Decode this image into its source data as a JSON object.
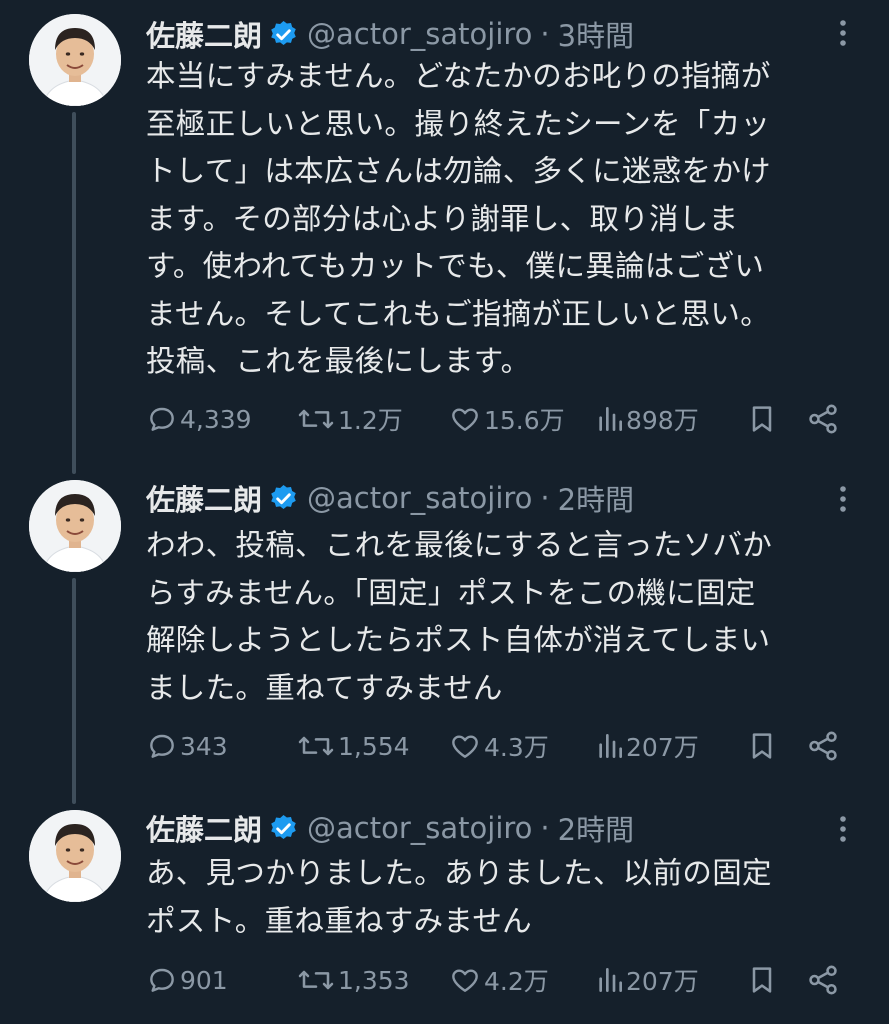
{
  "thread": [
    {
      "name": "佐藤二朗",
      "handle": "@actor_satojiro",
      "separator": "·",
      "time": "3時間",
      "lines": [
        "本当にすみません。どなたかのお叱りの指摘が",
        "至極正しいと思い。撮り終えたシーンを「カッ",
        "トして」は本広さんは勿論、多くに迷惑をかけ",
        "ます。その部分は心より謝罪し、取り消しま",
        "す。使われてもカットでも、僕に異論はござい",
        "ません。そしてこれもご指摘が正しいと思い。",
        "投稿、これを最後にします。"
      ],
      "replies": "4,339",
      "reposts": "1.2万",
      "likes": "15.6万",
      "views": "898万"
    },
    {
      "name": "佐藤二朗",
      "handle": "@actor_satojiro",
      "separator": "·",
      "time": "2時間",
      "lines": [
        "わわ、投稿、これを最後にすると言ったソバか",
        "らすみません。「固定」ポストをこの機に固定",
        "解除しようとしたらポスト自体が消えてしまい",
        "ました。重ねてすみません"
      ],
      "replies": "343",
      "reposts": "1,554",
      "likes": "4.3万",
      "views": "207万"
    },
    {
      "name": "佐藤二朗",
      "handle": "@actor_satojiro",
      "separator": "·",
      "time": "2時間",
      "lines": [
        "あ、見つかりました。ありました、以前の固定",
        "ポスト。重ね重ねすみません"
      ],
      "replies": "901",
      "reposts": "1,353",
      "likes": "4.2万",
      "views": "207万"
    }
  ],
  "icons": {
    "verified": "verified-badge-icon",
    "more": "more-options-icon",
    "reply": "reply-icon",
    "repost": "repost-icon",
    "like": "like-icon",
    "views": "views-icon",
    "bookmark": "bookmark-icon",
    "share": "share-icon"
  },
  "colors": {
    "background": "#15202b",
    "text": "#e7e9ea",
    "secondary": "#8b98a5",
    "verified": "#1d9bf0",
    "thread_line": "#3f4e5b"
  }
}
